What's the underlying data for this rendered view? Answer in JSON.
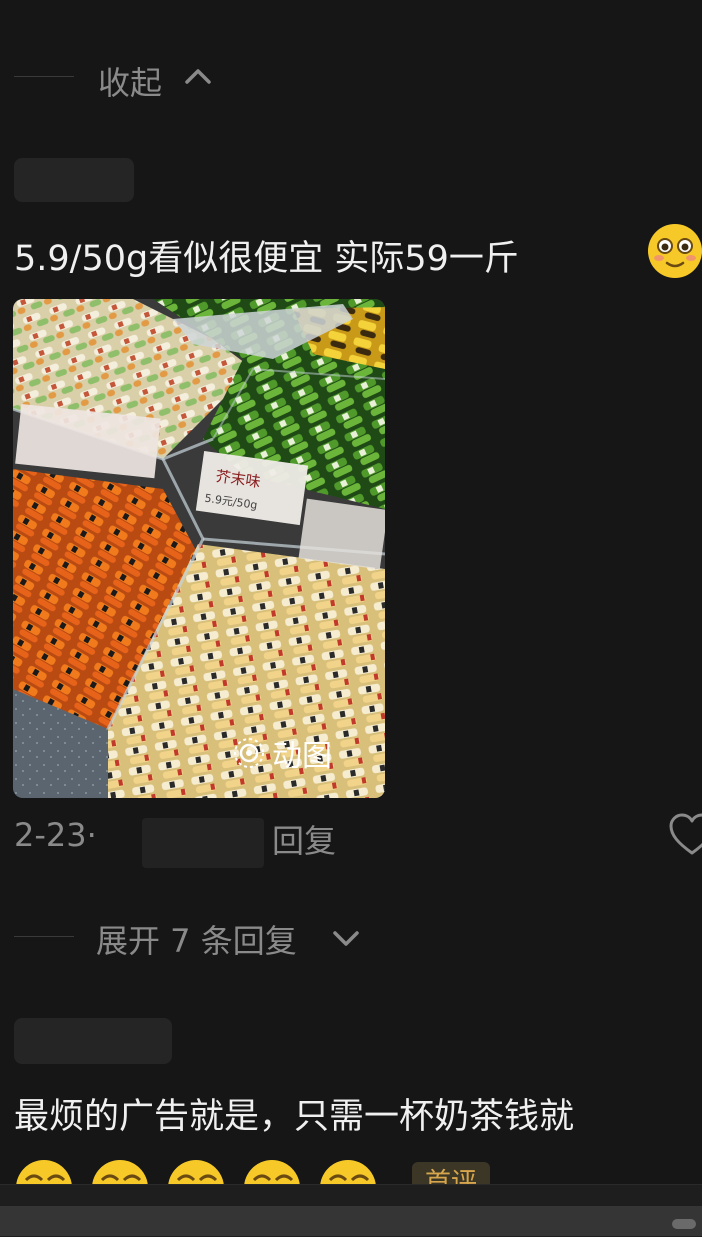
{
  "thread": {
    "collapse_label": "收起",
    "expand_label": "展开 7 条回复"
  },
  "comment1": {
    "text": "5.9/50g看似很便宜 实际59一斤",
    "gif_label": "动图",
    "date": "2-23",
    "date_sep": "·",
    "reply_label": "回复",
    "image": {
      "price_label": "芥末味",
      "price_value": "5.9元/50g"
    }
  },
  "comment2": {
    "text": "最烦的广告就是，只需一杯奶茶钱就",
    "tag": "首评"
  },
  "icons": {
    "collapse": "chevron-up-icon",
    "expand": "chevron-down-icon",
    "like": "heart-icon",
    "gif": "gif-icon",
    "emoji": "blushing-face-emoji"
  },
  "colors": {
    "background": "#161616",
    "text": "#f0f0f0",
    "muted": "#8a8a8a",
    "tag_bg": "#3b3626",
    "tag_text": "#d6a54c"
  }
}
